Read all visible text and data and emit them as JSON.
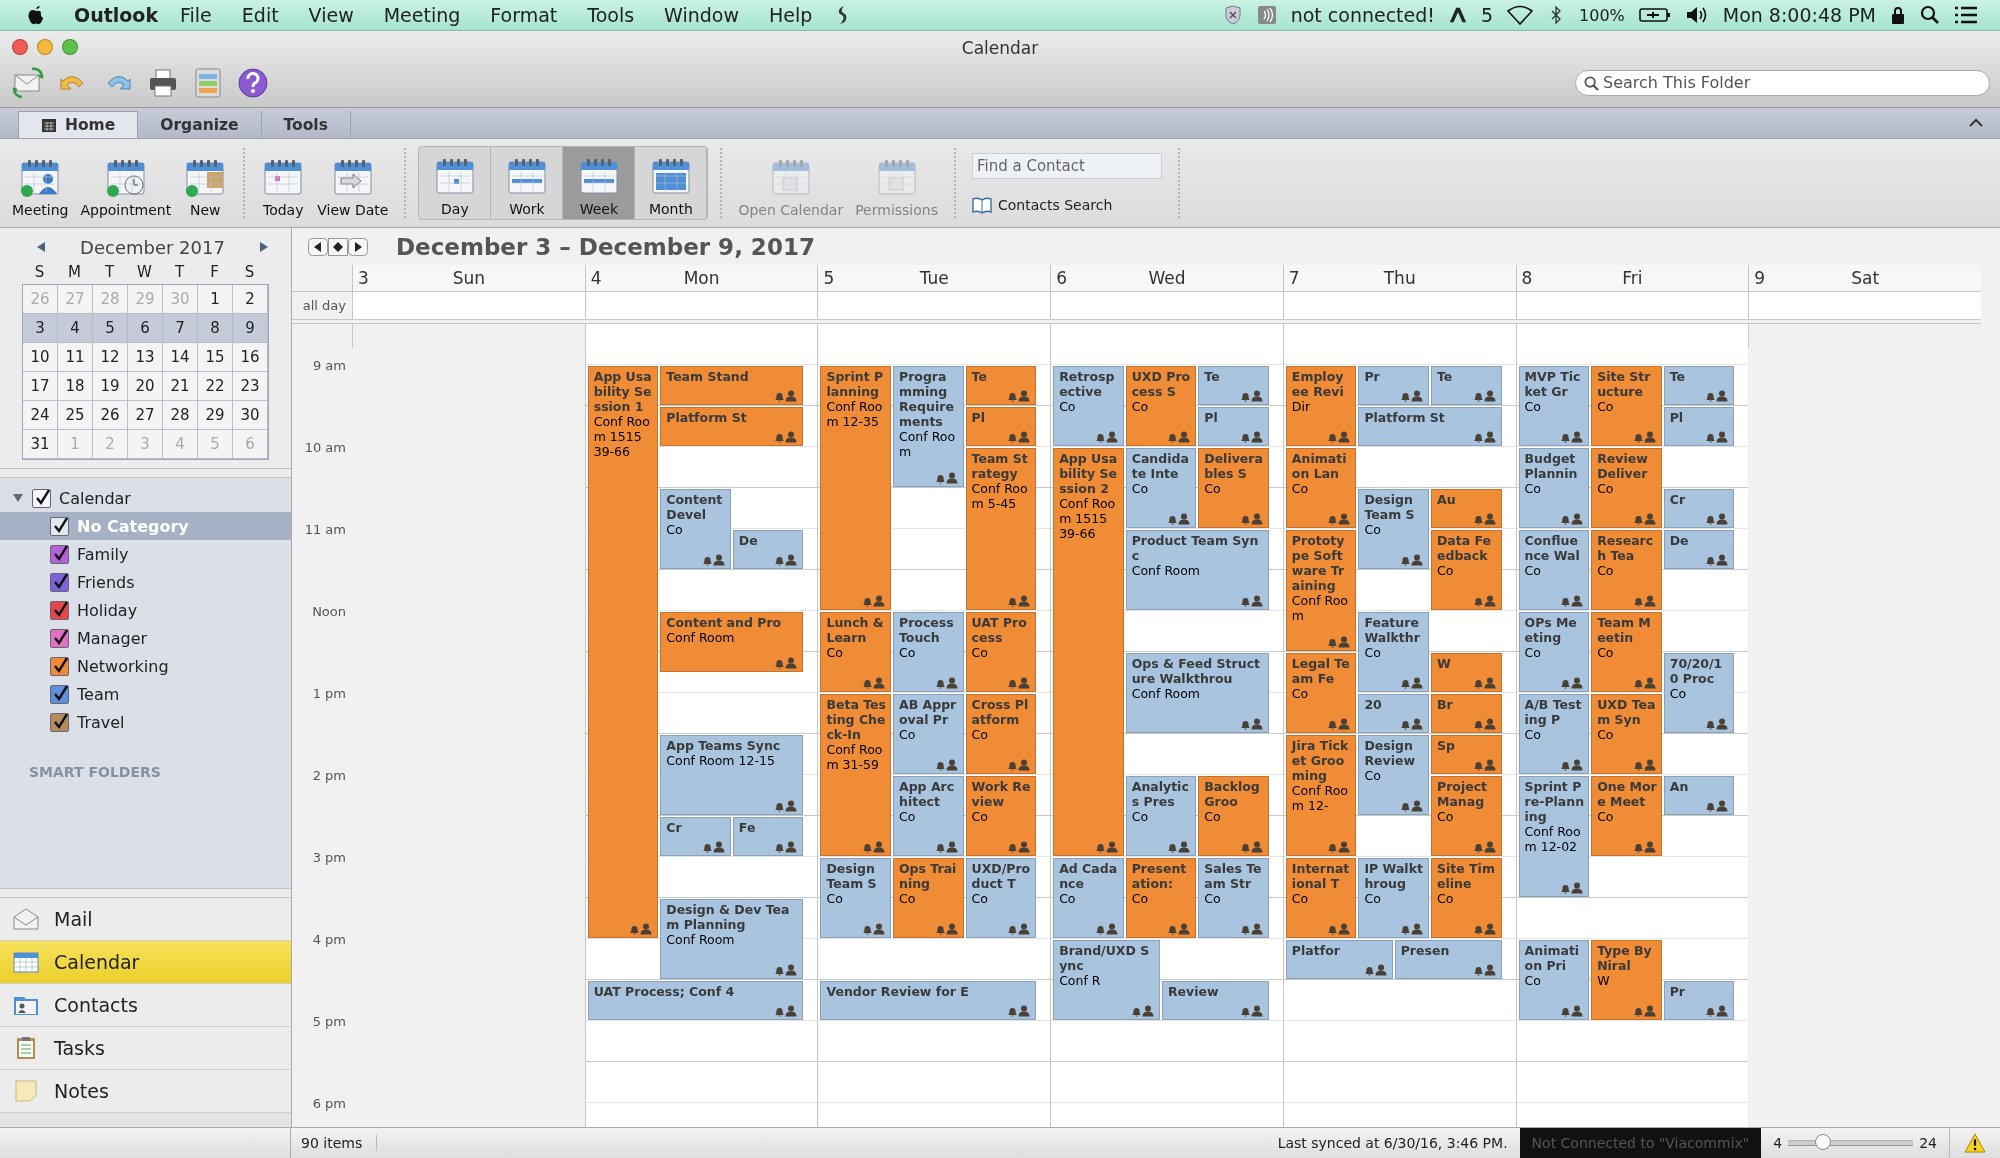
{
  "menu_bar": {
    "app": "Outlook",
    "menus": [
      "File",
      "Edit",
      "View",
      "Meeting",
      "Format",
      "Tools",
      "Window",
      "Help"
    ],
    "connection": "not connected!",
    "count": "5",
    "battery": "100%",
    "clock": "Mon 8:00:48 PM"
  },
  "window": {
    "title": "Calendar"
  },
  "search": {
    "placeholder": "Search This Folder"
  },
  "ribbon_tabs": [
    {
      "label": "Home",
      "selected": true
    },
    {
      "label": "Organize",
      "selected": false
    },
    {
      "label": "Tools",
      "selected": false
    }
  ],
  "ribbon": {
    "new_items": [
      {
        "label": "Meeting",
        "kind": "meeting"
      },
      {
        "label": "Appointment",
        "kind": "appointment"
      },
      {
        "label": "New",
        "kind": "new"
      }
    ],
    "go": [
      {
        "label": "Today",
        "kind": "today"
      },
      {
        "label": "View Date",
        "kind": "view-date"
      }
    ],
    "views": [
      {
        "label": "Day",
        "kind": "day",
        "selected": false
      },
      {
        "label": "Work",
        "kind": "work",
        "selected": false
      },
      {
        "label": "Week",
        "kind": "week",
        "selected": true
      },
      {
        "label": "Month",
        "kind": "month",
        "selected": false
      }
    ],
    "share": [
      {
        "label": "Open Calendar",
        "disabled": true
      },
      {
        "label": "Permissions",
        "disabled": true
      }
    ],
    "find_contact": {
      "placeholder": "Find a Contact"
    },
    "contacts_search": "Contacts Search"
  },
  "mini_calendar": {
    "month": "December 2017",
    "weekdays": [
      "S",
      "M",
      "T",
      "W",
      "T",
      "F",
      "S"
    ],
    "weeks": [
      {
        "selected": false,
        "days": [
          {
            "label": "26",
            "in_month": false
          },
          {
            "label": "27",
            "in_month": false
          },
          {
            "label": "28",
            "in_month": false
          },
          {
            "label": "29",
            "in_month": false
          },
          {
            "label": "30",
            "in_month": false
          },
          {
            "label": "1",
            "in_month": true
          },
          {
            "label": "2",
            "in_month": true
          }
        ]
      },
      {
        "selected": true,
        "days": [
          {
            "label": "3",
            "in_month": true
          },
          {
            "label": "4",
            "in_month": true
          },
          {
            "label": "5",
            "in_month": true
          },
          {
            "label": "6",
            "in_month": true
          },
          {
            "label": "7",
            "in_month": true
          },
          {
            "label": "8",
            "in_month": true
          },
          {
            "label": "9",
            "in_month": true
          }
        ]
      },
      {
        "selected": false,
        "days": [
          {
            "label": "10",
            "in_month": true
          },
          {
            "label": "11",
            "in_month": true
          },
          {
            "label": "12",
            "in_month": true
          },
          {
            "label": "13",
            "in_month": true
          },
          {
            "label": "14",
            "in_month": true
          },
          {
            "label": "15",
            "in_month": true
          },
          {
            "label": "16",
            "in_month": true
          }
        ]
      },
      {
        "selected": false,
        "days": [
          {
            "label": "17",
            "in_month": true
          },
          {
            "label": "18",
            "in_month": true
          },
          {
            "label": "19",
            "in_month": true
          },
          {
            "label": "20",
            "in_month": true
          },
          {
            "label": "21",
            "in_month": true
          },
          {
            "label": "22",
            "in_month": true
          },
          {
            "label": "23",
            "in_month": true
          }
        ]
      },
      {
        "selected": false,
        "days": [
          {
            "label": "24",
            "in_month": true
          },
          {
            "label": "25",
            "in_month": true
          },
          {
            "label": "26",
            "in_month": true
          },
          {
            "label": "27",
            "in_month": true
          },
          {
            "label": "28",
            "in_month": true
          },
          {
            "label": "29",
            "in_month": true
          },
          {
            "label": "30",
            "in_month": true
          }
        ]
      },
      {
        "selected": false,
        "days": [
          {
            "label": "31",
            "in_month": true
          },
          {
            "label": "1",
            "in_month": false
          },
          {
            "label": "2",
            "in_month": false
          },
          {
            "label": "3",
            "in_month": false
          },
          {
            "label": "4",
            "in_month": false
          },
          {
            "label": "5",
            "in_month": false
          },
          {
            "label": "6",
            "in_month": false
          }
        ]
      }
    ]
  },
  "folders": {
    "label": "Calendar",
    "checked": true,
    "expanded": true,
    "children": [
      {
        "label": "No Category",
        "checked": true,
        "selected": true,
        "color": "#e4e8ee"
      },
      {
        "label": "Family",
        "checked": true,
        "selected": false,
        "color": "#b463d6"
      },
      {
        "label": "Friends",
        "checked": true,
        "selected": false,
        "color": "#7d62d8"
      },
      {
        "label": "Holiday",
        "checked": true,
        "selected": false,
        "color": "#e2474a"
      },
      {
        "label": "Manager",
        "checked": true,
        "selected": false,
        "color": "#e070c4"
      },
      {
        "label": "Networking",
        "checked": true,
        "selected": false,
        "color": "#ef8a3c"
      },
      {
        "label": "Team",
        "checked": true,
        "selected": false,
        "color": "#5f8fd8"
      },
      {
        "label": "Travel",
        "checked": true,
        "selected": false,
        "color": "#b58c62"
      }
    ]
  },
  "smart_folders": "SMART FOLDERS",
  "nav": [
    {
      "label": "Mail",
      "kind": "mail",
      "selected": false
    },
    {
      "label": "Calendar",
      "kind": "calendar",
      "selected": true
    },
    {
      "label": "Contacts",
      "kind": "contacts",
      "selected": false
    },
    {
      "label": "Tasks",
      "kind": "tasks",
      "selected": false
    },
    {
      "label": "Notes",
      "kind": "notes",
      "selected": false
    }
  ],
  "calendar": {
    "range": "December 3 – December 9, 2017",
    "all_day_label": "all day",
    "hours": [
      "9 am",
      "10 am",
      "11 am",
      "Noon",
      "1 pm",
      "2 pm",
      "3 pm",
      "4 pm",
      "5 pm",
      "6 pm"
    ],
    "days": [
      {
        "number": "3",
        "name": "Sun"
      },
      {
        "number": "4",
        "name": "Mon",
        "events": [
          {
            "title": "App Usability Session 1",
            "location": "Conf Room 1515 39-66",
            "color": "#f08b36"
          },
          {
            "title": "Team Stand",
            "color": "#f08b36"
          },
          {
            "title": "Platform St",
            "color": "#f08b36"
          },
          {
            "title": "Content Devel",
            "location": "Co",
            "color": "#a8c4df"
          },
          {
            "title": "De",
            "color": "#a8c4df"
          },
          {
            "title": "Content and Pro",
            "location": "Conf Room",
            "color": "#f08b36"
          },
          {
            "title": "App Teams Sync",
            "location": "Conf Room 12-15",
            "color": "#a8c4df"
          },
          {
            "title": "Cr",
            "color": "#a8c4df"
          },
          {
            "title": "Fe",
            "color": "#a8c4df"
          },
          {
            "title": "Design & Dev Team Planning",
            "location": "Conf Room",
            "color": "#a8c4df"
          },
          {
            "title": "UAT Process; Conf 4",
            "color": "#a8c4df"
          }
        ]
      },
      {
        "number": "5",
        "name": "Tue",
        "events": [
          {
            "title": "Sprint Planning",
            "location": "Conf Room 12-35",
            "color": "#f08b36"
          },
          {
            "title": "Programming Requirements",
            "location": "Conf Room",
            "color": "#a8c4df"
          },
          {
            "title": "Te",
            "color": "#f08b36"
          },
          {
            "title": "Pl",
            "color": "#f08b36"
          },
          {
            "title": "Team Strategy",
            "location": "Conf Room 5-45",
            "color": "#f08b36"
          },
          {
            "title": "Lunch & Learn",
            "location": "Co",
            "color": "#f08b36"
          },
          {
            "title": "Process Touch",
            "location": "Co",
            "color": "#a8c4df"
          },
          {
            "title": "UAT Process",
            "location": "Co",
            "color": "#f08b36"
          },
          {
            "title": "Beta Testing Check-In",
            "location": "Conf Room 31-59",
            "color": "#f08b36"
          },
          {
            "title": "AB Approval Pr",
            "location": "Co",
            "color": "#a8c4df"
          },
          {
            "title": "Cross Platform",
            "location": "Co",
            "color": "#f08b36"
          },
          {
            "title": "App Architect",
            "location": "Co",
            "color": "#a8c4df"
          },
          {
            "title": "Work Review",
            "location": "Co",
            "color": "#f08b36"
          },
          {
            "title": "Design Team S",
            "location": "Co",
            "color": "#a8c4df"
          },
          {
            "title": "Ops Training",
            "location": "Co",
            "color": "#f08b36"
          },
          {
            "title": "UXD/Product T",
            "location": "Co",
            "color": "#a8c4df"
          },
          {
            "title": "Vendor Review for E",
            "color": "#a8c4df"
          }
        ]
      },
      {
        "number": "6",
        "name": "Wed",
        "events": [
          {
            "title": "Retrospective",
            "location": "Co",
            "color": "#a8c4df"
          },
          {
            "title": "UXD Process S",
            "location": "Co",
            "color": "#f08b36"
          },
          {
            "title": "Te",
            "color": "#a8c4df"
          },
          {
            "title": "Pl",
            "color": "#a8c4df"
          },
          {
            "title": "App Usability Session 2",
            "location": "Conf Room 1515 39-66",
            "color": "#f08b36"
          },
          {
            "title": "Candidate Inte",
            "location": "Co",
            "color": "#a8c4df"
          },
          {
            "title": "Deliverables S",
            "location": "Co",
            "color": "#f08b36"
          },
          {
            "title": "Product Team Sync",
            "location": "Conf Room",
            "color": "#a8c4df"
          },
          {
            "title": "Ops & Feed Structure Walkthrou",
            "location": "Conf Room",
            "color": "#a8c4df"
          },
          {
            "title": "Analytics Pres",
            "location": "Co",
            "color": "#a8c4df"
          },
          {
            "title": "Backlog Groo",
            "location": "Co",
            "color": "#f08b36"
          },
          {
            "title": "Ad Cadance",
            "location": "Co",
            "color": "#a8c4df"
          },
          {
            "title": "Presentation:",
            "location": "Co",
            "color": "#f08b36"
          },
          {
            "title": "Sales Team Str",
            "location": "Co",
            "color": "#a8c4df"
          },
          {
            "title": "Brand/UXD Sync",
            "location": "Conf R",
            "color": "#a8c4df"
          },
          {
            "title": "Review",
            "color": "#a8c4df"
          }
        ]
      },
      {
        "number": "7",
        "name": "Thu",
        "events": [
          {
            "title": "Employee Revi",
            "location": "Dir",
            "color": "#f08b36"
          },
          {
            "title": "Pr",
            "color": "#a8c4df"
          },
          {
            "title": "Te",
            "color": "#a8c4df"
          },
          {
            "title": "Platform St",
            "color": "#a8c4df"
          },
          {
            "title": "Animation Lan",
            "location": "Co",
            "color": "#f08b36"
          },
          {
            "title": "Design Team S",
            "location": "Co",
            "color": "#a8c4df"
          },
          {
            "title": "Au",
            "color": "#f08b36"
          },
          {
            "title": "Prototype Software Training",
            "location": "Conf Room",
            "color": "#f08b36"
          },
          {
            "title": "Data Feedback",
            "location": "Co",
            "color": "#f08b36"
          },
          {
            "title": "Feature Walkthr",
            "location": "Co",
            "color": "#a8c4df"
          },
          {
            "title": "Legal Team Fe",
            "location": "Co",
            "color": "#f08b36"
          },
          {
            "title": "W",
            "color": "#f08b36"
          },
          {
            "title": "20",
            "color": "#a8c4df"
          },
          {
            "title": "Br",
            "color": "#f08b36"
          },
          {
            "title": "Jira Ticket Grooming",
            "location": "Conf Room 12-",
            "color": "#f08b36"
          },
          {
            "title": "Design Review",
            "location": "Co",
            "color": "#a8c4df"
          },
          {
            "title": "Sp",
            "color": "#f08b36"
          },
          {
            "title": "Project Manag",
            "location": "Co",
            "color": "#f08b36"
          },
          {
            "title": "International T",
            "location": "Co",
            "color": "#f08b36"
          },
          {
            "title": "IP Walkthroug",
            "location": "Co",
            "color": "#a8c4df"
          },
          {
            "title": "Site Timeline",
            "location": "Co",
            "color": "#f08b36"
          },
          {
            "title": "Platfor",
            "color": "#a8c4df"
          },
          {
            "title": "Presen",
            "color": "#a8c4df"
          }
        ]
      },
      {
        "number": "8",
        "name": "Fri",
        "events": [
          {
            "title": "MVP Ticket Gr",
            "location": "Co",
            "color": "#a8c4df"
          },
          {
            "title": "Site Structure",
            "location": "Co",
            "color": "#f08b36"
          },
          {
            "title": "Te",
            "color": "#a8c4df"
          },
          {
            "title": "Pl",
            "color": "#a8c4df"
          },
          {
            "title": "Budget Plannin",
            "location": "Co",
            "color": "#a8c4df"
          },
          {
            "title": "Review Deliver",
            "location": "Co",
            "color": "#f08b36"
          },
          {
            "title": "Cr",
            "color": "#a8c4df"
          },
          {
            "title": "Confluence Wal",
            "location": "Co",
            "color": "#a8c4df"
          },
          {
            "title": "Research Tea",
            "location": "Co",
            "color": "#f08b36"
          },
          {
            "title": "De",
            "color": "#a8c4df"
          },
          {
            "title": "OPs Meeting",
            "location": "Co",
            "color": "#a8c4df"
          },
          {
            "title": "Team Meetin",
            "location": "Co",
            "color": "#f08b36"
          },
          {
            "title": "70/20/10 Proc",
            "location": "Co",
            "color": "#a8c4df"
          },
          {
            "title": "A/B Testing P",
            "location": "Co",
            "color": "#a8c4df"
          },
          {
            "title": "UXD Team Syn",
            "location": "Co",
            "color": "#f08b36"
          },
          {
            "title": "Sprint Pre-Planning",
            "location": "Conf Room 12-02",
            "color": "#a8c4df"
          },
          {
            "title": "One More Meet",
            "location": "Co",
            "color": "#f08b36"
          },
          {
            "title": "An",
            "color": "#a8c4df"
          },
          {
            "title": "Animation Pri",
            "location": "Co",
            "color": "#a8c4df"
          },
          {
            "title": "Type By Niral",
            "location": "W",
            "color": "#f08b36"
          },
          {
            "title": "Pr",
            "color": "#a8c4df"
          }
        ]
      },
      {
        "number": "9",
        "name": "Sat"
      }
    ]
  },
  "status_bar": {
    "items": "90 items",
    "synced": "Last synced at 6/30/16, 3:46 PM.",
    "connection": "Not Connected to \"Viacommix\"",
    "zoom_min": "4",
    "zoom_max": "24",
    "zoom": {
      "level": 0.28
    }
  }
}
